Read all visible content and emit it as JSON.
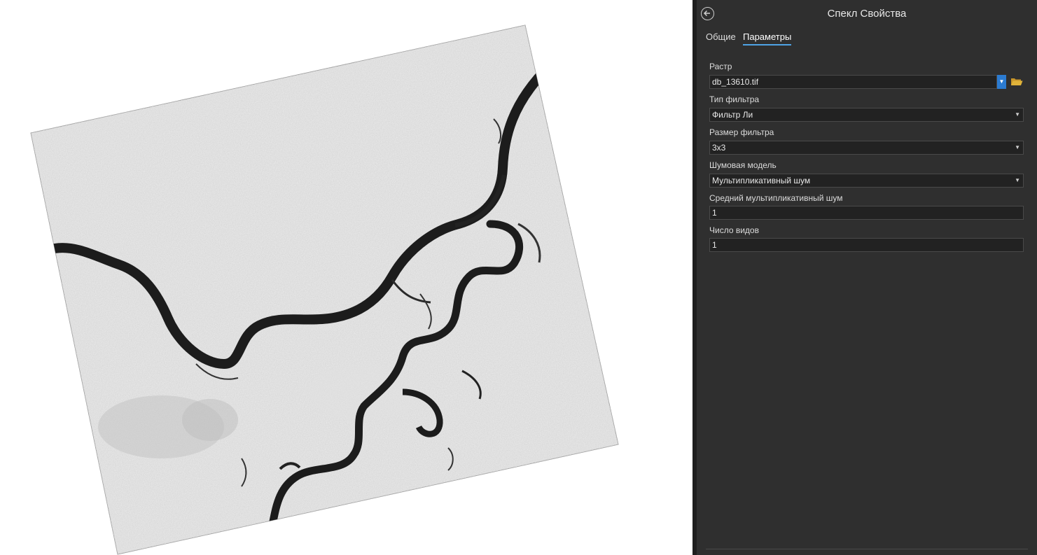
{
  "pane": {
    "title": "Спекл Свойства",
    "tabs": [
      {
        "label": "Общие",
        "active": false
      },
      {
        "label": "Параметры",
        "active": true
      }
    ],
    "params": {
      "raster": {
        "label": "Растр",
        "value": "db_13610.tif"
      },
      "filter_type": {
        "label": "Тип фильтра",
        "value": "Фильтр Ли"
      },
      "filter_size": {
        "label": "Размер фильтра",
        "value": "3x3"
      },
      "noise_model": {
        "label": "Шумовая модель",
        "value": "Мультипликативный шум"
      },
      "mean_noise": {
        "label": "Средний мультипликативный шум",
        "value": "1"
      },
      "num_looks": {
        "label": "Число видов",
        "value": "1"
      }
    }
  },
  "icons": {
    "back": "back-arrow-icon",
    "dropdown": "chevron-down-icon",
    "browse": "folder-icon"
  },
  "colors": {
    "pane_bg": "#2f2f2f",
    "field_bg": "#222222",
    "accent": "#4fa3e6",
    "dropdown_accent": "#2b7bd1",
    "folder": "#e0b33a",
    "image_bg": "#d9d9d9",
    "river": "#1a1a1a"
  }
}
